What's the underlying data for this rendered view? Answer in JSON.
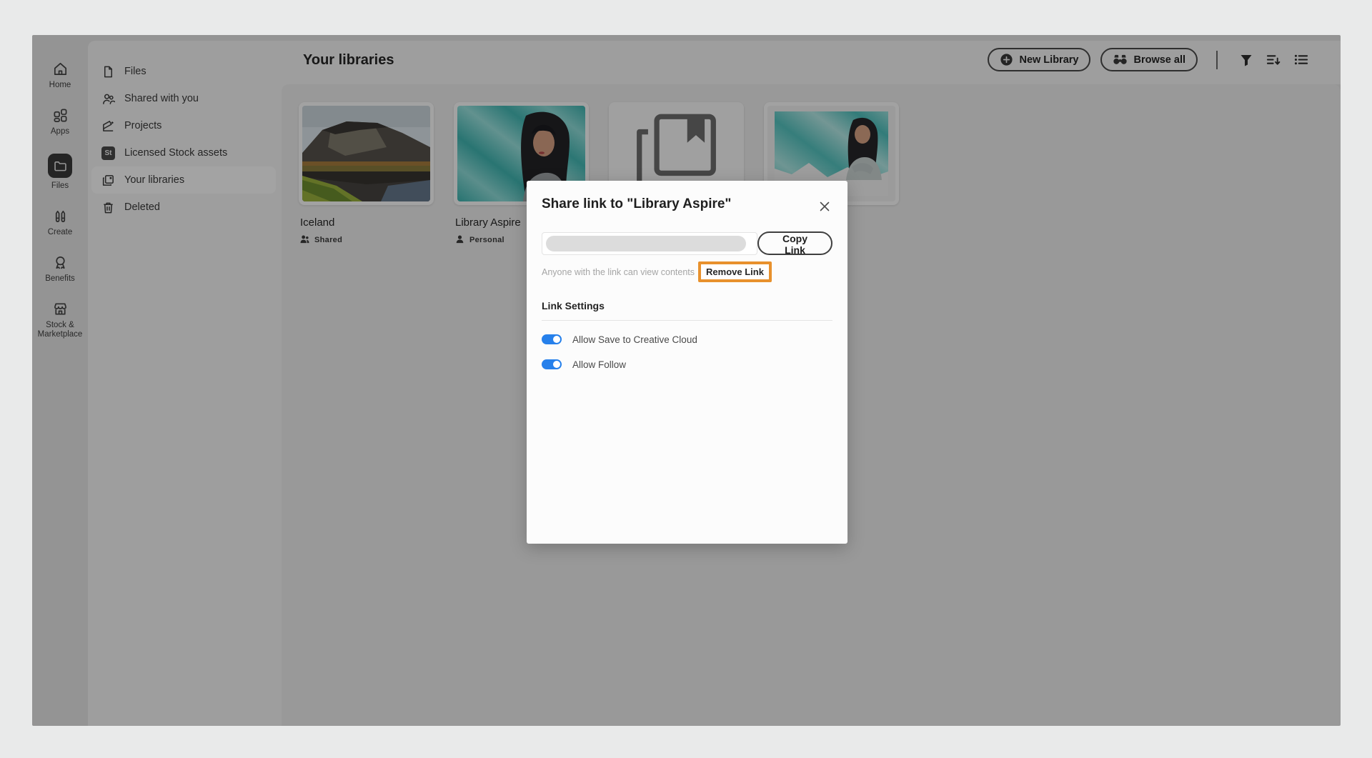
{
  "rail": {
    "items": [
      {
        "label": "Home"
      },
      {
        "label": "Apps"
      },
      {
        "label": "Files",
        "selected": true
      },
      {
        "label": "Create"
      },
      {
        "label": "Benefits"
      },
      {
        "label": "Stock & Marketplace"
      }
    ]
  },
  "sidebar": {
    "items": [
      {
        "label": "Files"
      },
      {
        "label": "Shared with you"
      },
      {
        "label": "Projects"
      },
      {
        "label": "Licensed Stock assets",
        "badge": "St"
      },
      {
        "label": "Your libraries",
        "selected": true
      },
      {
        "label": "Deleted"
      }
    ]
  },
  "header": {
    "title": "Your libraries",
    "new_library_label": "New Library",
    "browse_all_label": "Browse all"
  },
  "libraries": [
    {
      "name": "Iceland",
      "access": "Shared"
    },
    {
      "name": "Library Aspire",
      "access": "Personal"
    },
    {
      "name": "",
      "access": ""
    },
    {
      "name": "",
      "access": ""
    }
  ],
  "modal": {
    "title": "Share link to \"Library Aspire\"",
    "link_value": "",
    "copy_label": "Copy Link",
    "caption": "Anyone with the link can view contents",
    "remove_label": "Remove Link",
    "settings_title": "Link Settings",
    "toggles": [
      {
        "label": "Allow Save to Creative Cloud",
        "on": true
      },
      {
        "label": "Allow Follow",
        "on": true
      }
    ]
  },
  "colors": {
    "annotation_orange": "#e8912d",
    "toggle_blue": "#2680eb",
    "dim_overlay": "rgba(0,0,0,0.36)"
  }
}
